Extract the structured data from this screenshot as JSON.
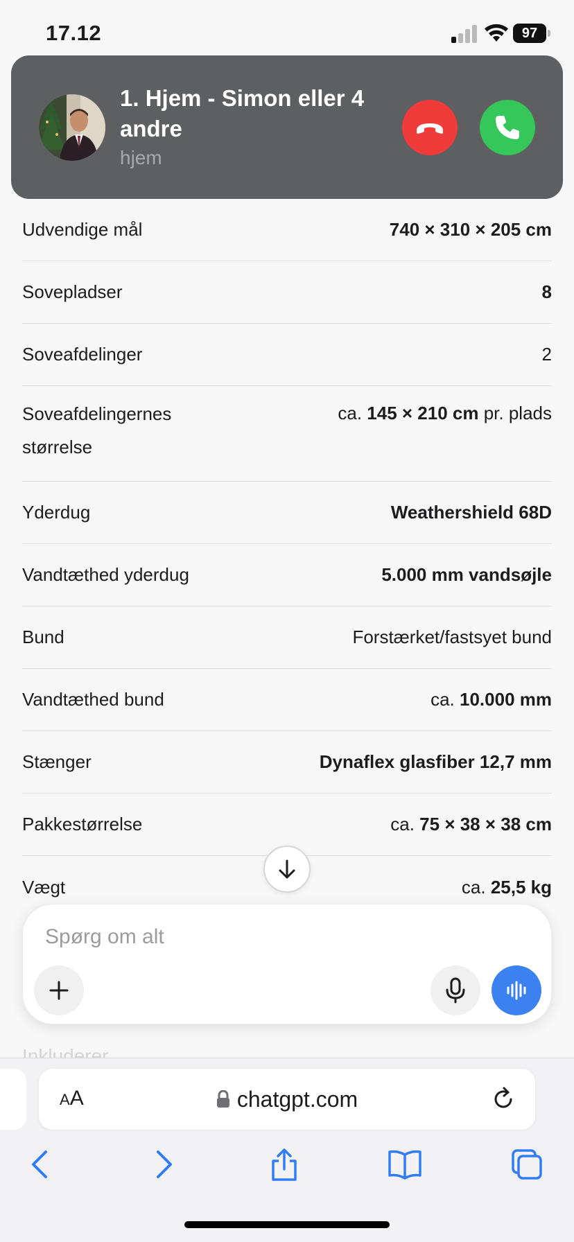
{
  "status_bar": {
    "time": "17.12",
    "battery": "97"
  },
  "call": {
    "name": "1. Hjem - Simon eller 4 andre",
    "subtitle": "hjem",
    "decline_icon": "phone-hangup-icon",
    "accept_icon": "phone-icon",
    "colors": {
      "banner": "#5e5f61",
      "decline": "#ef3b3a",
      "accept": "#35c759"
    }
  },
  "specs": [
    {
      "label": "Udvendige mål",
      "value_prefix": "",
      "value_bold": "740 × 310 × 205 cm",
      "value_suffix": ""
    },
    {
      "label": "Sovepladser",
      "value_prefix": "",
      "value_bold": "8",
      "value_suffix": ""
    },
    {
      "label": "Soveafdelinger",
      "value_prefix": "2",
      "value_bold": "",
      "value_suffix": ""
    },
    {
      "label": "Soveafdelingernes størrelse",
      "value_prefix": "ca. ",
      "value_bold": "145 × 210 cm",
      "value_suffix": " pr. plads"
    },
    {
      "label": "Yderdug",
      "value_prefix": "",
      "value_bold": "Weathershield 68D",
      "value_suffix": ""
    },
    {
      "label": "Vandtæthed yderdug",
      "value_prefix": "",
      "value_bold": "5.000 mm vandsøjle",
      "value_suffix": ""
    },
    {
      "label": "Bund",
      "value_prefix": "Forstærket/fastsyet bund",
      "value_bold": "",
      "value_suffix": ""
    },
    {
      "label": "Vandtæthed bund",
      "value_prefix": "ca. ",
      "value_bold": "10.000 mm",
      "value_suffix": ""
    },
    {
      "label": "Stænger",
      "value_prefix": "",
      "value_bold": "Dynaflex glasfiber 12,7 mm",
      "value_suffix": ""
    },
    {
      "label": "Pakkestørrelse",
      "value_prefix": "ca. ",
      "value_bold": "75 × 38 × 38 cm",
      "value_suffix": ""
    },
    {
      "label": "Vægt",
      "value_prefix": "ca. ",
      "value_bold": "25,5 kg",
      "value_suffix": ""
    }
  ],
  "composer": {
    "placeholder": "Spørg om alt",
    "plus_icon": "plus-icon",
    "mic_icon": "microphone-icon",
    "voice_icon": "voice-waveform-icon",
    "voice_color": "#3b82f0"
  },
  "faded_text": "Inkluderer",
  "safari": {
    "aa_label_small": "A",
    "aa_label_big": "A",
    "url": "chatgpt.com",
    "toolbar_icons": [
      "back-arrow-icon",
      "forward-arrow-icon",
      "share-icon",
      "bookmarks-icon",
      "tabs-icon"
    ],
    "accent": "#2f7cf6"
  }
}
